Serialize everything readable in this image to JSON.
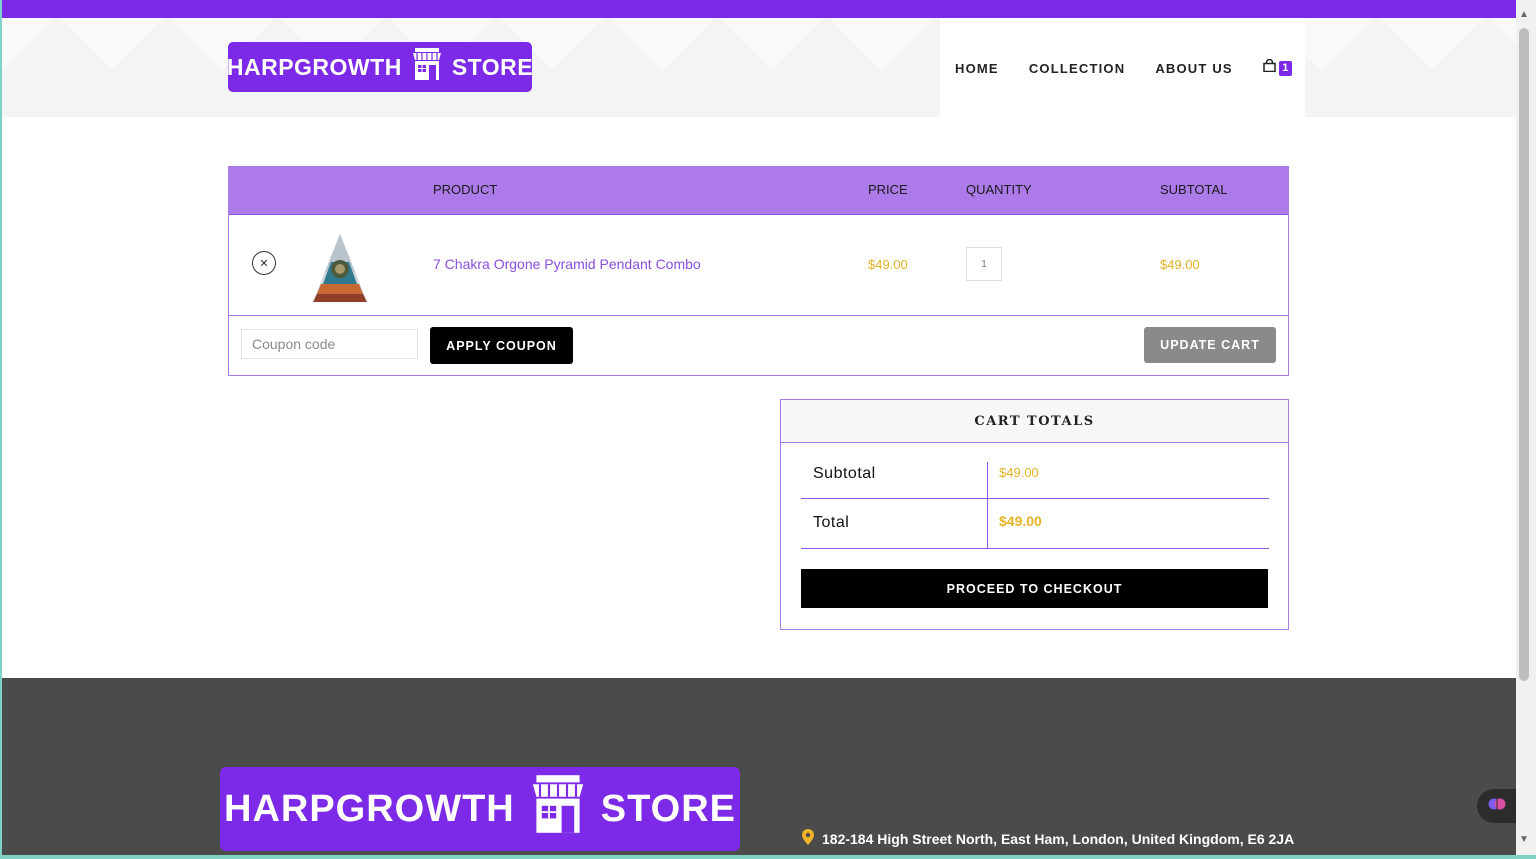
{
  "brand": {
    "name_left": "HARPGROWTH",
    "name_right": "STORE"
  },
  "nav": {
    "items": [
      "HOME",
      "COLLECTION",
      "ABOUT US"
    ],
    "cart_count": "1"
  },
  "cart": {
    "headers": {
      "product": "PRODUCT",
      "price": "PRICE",
      "quantity": "QUANTITY",
      "subtotal": "SUBTOTAL"
    },
    "items": [
      {
        "name": "7 Chakra Orgone Pyramid Pendant Combo",
        "price": "$49.00",
        "quantity": "1",
        "subtotal": "$49.00"
      }
    ],
    "coupon_placeholder": "Coupon code",
    "apply_label": "APPLY COUPON",
    "update_label": "UPDATE CART"
  },
  "totals": {
    "title": "CART TOTALS",
    "subtotal_label": "Subtotal",
    "subtotal_value": "$49.00",
    "total_label": "Total",
    "total_value": "$49.00",
    "checkout_label": "PROCEED TO CHECKOUT"
  },
  "footer": {
    "address": "182-184 High Street North, East Ham, London, United Kingdom, E6 2JA"
  },
  "colors": {
    "accent": "#7c2ae8",
    "header_row": "#ac7ae9",
    "price": "#e6b325",
    "footer_bg": "#4b4b4b"
  }
}
